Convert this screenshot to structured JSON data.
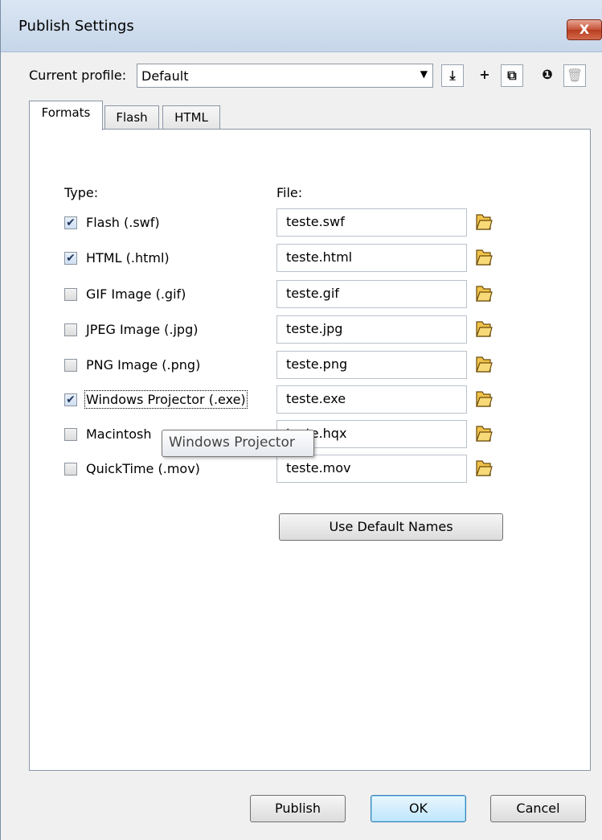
{
  "window": {
    "title": "Publish Settings",
    "close_label": "X"
  },
  "profile": {
    "label": "Current profile:",
    "value": "Default",
    "toolbar": [
      {
        "name": "import-export-profile-icon",
        "glyph": "⤓"
      },
      {
        "name": "create-profile-icon",
        "glyph": "+"
      },
      {
        "name": "duplicate-profile-icon",
        "glyph": "⧉"
      },
      {
        "name": "profile-properties-icon",
        "glyph": "❶"
      },
      {
        "name": "delete-profile-icon",
        "glyph": "🗑"
      }
    ]
  },
  "tabs": [
    {
      "label": "Formats",
      "active": true
    },
    {
      "label": "Flash",
      "active": false
    },
    {
      "label": "HTML",
      "active": false
    }
  ],
  "formats": {
    "type_header": "Type:",
    "file_header": "File:",
    "rows": [
      {
        "label": "Flash  (.swf)",
        "checked": true,
        "file": "teste.swf"
      },
      {
        "label": "HTML  (.html)",
        "checked": true,
        "file": "teste.html"
      },
      {
        "label": "GIF Image (.gif)",
        "checked": false,
        "file": "teste.gif"
      },
      {
        "label": "JPEG Image (.jpg)",
        "checked": false,
        "file": "teste.jpg"
      },
      {
        "label": "PNG Image (.png)",
        "checked": false,
        "file": "teste.png"
      },
      {
        "label": "Windows Projector (.exe)",
        "checked": true,
        "file": "teste.exe"
      },
      {
        "label": "Macintosh",
        "checked": false,
        "file": "teste.hqx"
      },
      {
        "label": "QuickTime (.mov)",
        "checked": false,
        "file": "teste.mov"
      }
    ],
    "use_default_names": "Use Default Names"
  },
  "tooltip": {
    "text": "Windows Projector"
  },
  "buttons": {
    "publish": "Publish",
    "ok": "OK",
    "cancel": "Cancel"
  },
  "colors": {
    "folder": "#f0c24a",
    "title_bar": "#c6d6e9"
  }
}
